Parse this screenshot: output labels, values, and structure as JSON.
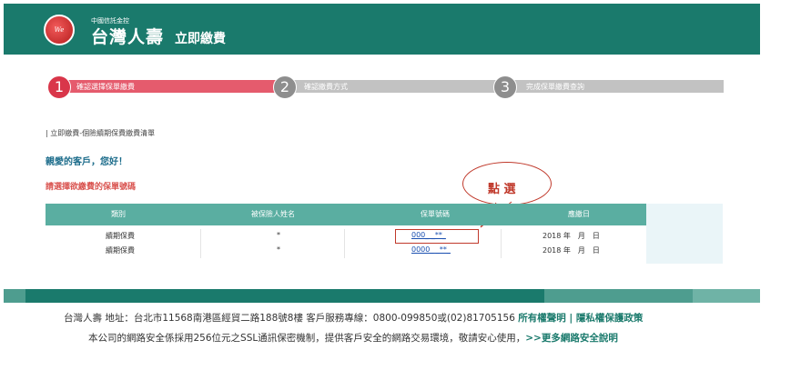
{
  "header": {
    "logo_text": "We Shining",
    "brand_small": "中國信託金控",
    "brand_name": "台灣人壽",
    "page_name": "立即繳費"
  },
  "steps": [
    {
      "number": "1",
      "label": "確認選擇保單繳費",
      "active": true
    },
    {
      "number": "2",
      "label": "確認繳費方式",
      "active": false
    },
    {
      "number": "3",
      "label": "完成保單繳費查詢",
      "active": false
    }
  ],
  "section_title": "| 立即繳費-個險續期保費繳費清單",
  "greeting": "親愛的客戶，您好！",
  "prompt": "請選擇欲繳費的保單號碼",
  "annotation": "點 選",
  "table": {
    "headers": [
      "類別",
      "被保險人姓名",
      "保單號碼",
      "應繳日"
    ],
    "rows": [
      {
        "type": "續期保費",
        "name": "*",
        "policy": "000_ _**_",
        "date": "2018 年　月　日"
      },
      {
        "type": "續期保費",
        "name": "*",
        "policy": "0000_ _**_",
        "date": "2018 年　月　日"
      }
    ]
  },
  "footer": {
    "line1_text": "台灣人壽 地址：台北市11568南港區經貿二路188號8樓 客戶服務專線：0800-099850或(02)81705156",
    "line1_link1": "所有權聲明",
    "line1_sep": " | ",
    "line1_link2": "隱私權保護政策",
    "line2_text": "本公司的網路安全係採用256位元之SSL通訊保密機制，提供客戶安全的網路交易環境，敬請安心使用，",
    "line2_link": ">>更多網路安全說明"
  },
  "colors": {
    "brand_teal": "#1a7a6c",
    "table_header": "#5aaea1",
    "step_active": "#e55b6d",
    "step_inactive": "#c2c2c2",
    "annotation_red": "#c0392b"
  }
}
